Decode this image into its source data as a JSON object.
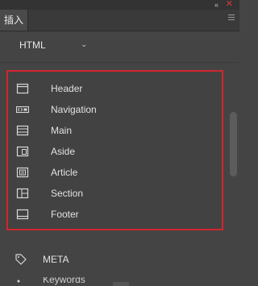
{
  "panel": {
    "tab_label": "插入",
    "category_selected": "HTML",
    "accent_color": "#d2262e"
  },
  "items": [
    {
      "label": "Header",
      "icon": "header-icon"
    },
    {
      "label": "Navigation",
      "icon": "navigation-icon"
    },
    {
      "label": "Main",
      "icon": "main-icon"
    },
    {
      "label": "Aside",
      "icon": "aside-icon"
    },
    {
      "label": "Article",
      "icon": "article-icon"
    },
    {
      "label": "Section",
      "icon": "section-icon"
    },
    {
      "label": "Footer",
      "icon": "footer-icon"
    }
  ],
  "more_items": [
    {
      "label": "META",
      "icon": "tag-icon"
    },
    {
      "label": "Keywords",
      "icon": "keywords-icon"
    }
  ]
}
